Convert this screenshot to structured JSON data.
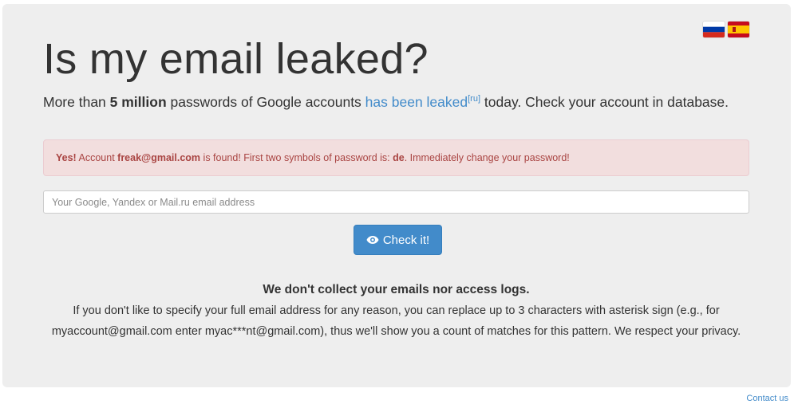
{
  "header": {
    "title": "Is my email leaked?",
    "lead_prefix": "More than ",
    "lead_bold": "5 million",
    "lead_middle": " passwords of Google accounts ",
    "lead_link": "has been leaked",
    "lead_sup": "[ru]",
    "lead_suffix": " today. Check your account in database."
  },
  "flags": [
    {
      "name": "russian-flag",
      "colors": [
        "#ffffff",
        "#0039a6",
        "#d52b1e"
      ]
    },
    {
      "name": "spanish-flag",
      "colors": [
        "#c60b1e",
        "#ffc400",
        "#c60b1e"
      ]
    }
  ],
  "alert": {
    "prefix": "Yes!",
    "text1": " Account ",
    "email": "freak@gmail.com",
    "text2": " is found! First two symbols of password is: ",
    "symbols": "de",
    "text3": ". Immediately change your password!"
  },
  "search": {
    "placeholder": "Your Google, Yandex or Mail.ru email address",
    "value": ""
  },
  "check_button": {
    "label": "Check it!",
    "icon": "eye-icon"
  },
  "privacy": {
    "heading": "We don't collect your emails nor access logs.",
    "text": "If you don't like to specify your full email address for any reason, you can replace up to 3 characters with asterisk sign (e.g., for myaccount@gmail.com enter myac***nt@gmail.com), thus we'll show you a count of matches for this pattern. We respect your privacy."
  },
  "footer": {
    "contact_label": "Contact us"
  },
  "colors": {
    "background": "#eeeeee",
    "accent": "#428bca",
    "alert_bg": "#f2dede",
    "alert_text": "#a94442"
  }
}
